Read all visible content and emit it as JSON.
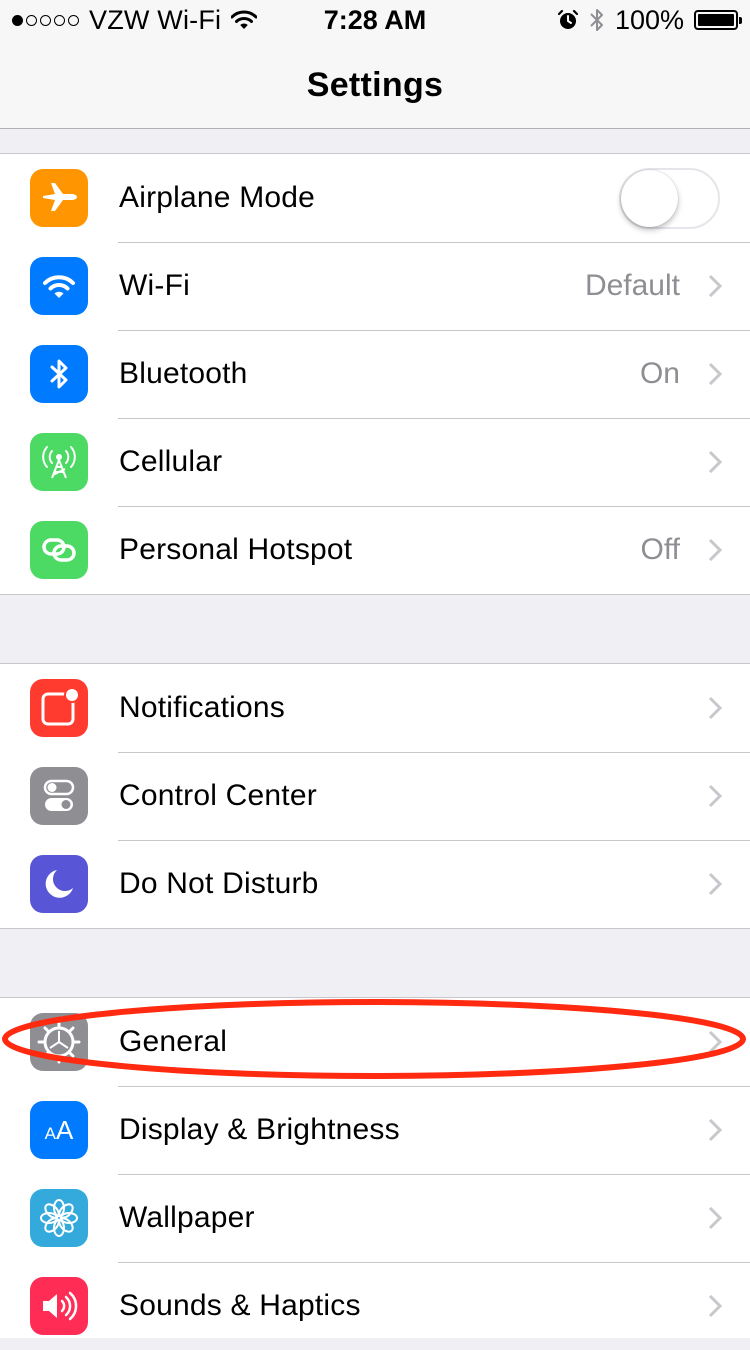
{
  "status_bar": {
    "carrier": "VZW Wi-Fi",
    "time": "7:28 AM",
    "battery": "100%",
    "signal_bars_filled": 1,
    "signal_bars_total": 5,
    "icons": [
      "wifi-icon",
      "alarm-icon",
      "bluetooth-icon",
      "battery-icon"
    ]
  },
  "nav": {
    "title": "Settings"
  },
  "groups": [
    {
      "rows": [
        {
          "label": "Airplane Mode",
          "icon": "airplane-icon",
          "color": "#ff9500",
          "toggle": false
        },
        {
          "label": "Wi-Fi",
          "icon": "wifi-icon",
          "color": "#007aff",
          "detail": "Default"
        },
        {
          "label": "Bluetooth",
          "icon": "bluetooth-icon",
          "color": "#007aff",
          "detail": "On"
        },
        {
          "label": "Cellular",
          "icon": "cellular-antenna-icon",
          "color": "#4cd964",
          "detail": ""
        },
        {
          "label": "Personal Hotspot",
          "icon": "hotspot-link-icon",
          "color": "#4cd964",
          "detail": "Off"
        }
      ]
    },
    {
      "rows": [
        {
          "label": "Notifications",
          "icon": "notifications-icon",
          "color": "#ff3b30"
        },
        {
          "label": "Control Center",
          "icon": "control-center-icon",
          "color": "#8e8e93"
        },
        {
          "label": "Do Not Disturb",
          "icon": "moon-icon",
          "color": "#5856d6"
        }
      ]
    },
    {
      "rows": [
        {
          "label": "General",
          "icon": "gear-icon",
          "color": "#8e8e93"
        },
        {
          "label": "Display & Brightness",
          "icon": "text-size-icon",
          "color": "#007aff",
          "icon_text": "AA"
        },
        {
          "label": "Wallpaper",
          "icon": "flower-icon",
          "color": "#34aadc"
        },
        {
          "label": "Sounds & Haptics",
          "icon": "speaker-icon",
          "color": "#ff2d55"
        }
      ]
    }
  ],
  "annotation": {
    "color": "#ff2a10",
    "target": "General"
  }
}
